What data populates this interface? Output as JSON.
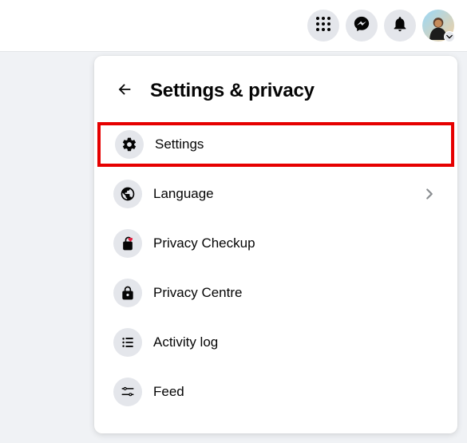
{
  "header": {
    "title": "Settings & privacy"
  },
  "topbar": {
    "icons": {
      "menu": "apps-grid-icon",
      "messenger": "messenger-icon",
      "notifications": "bell-icon",
      "account": "account-avatar"
    }
  },
  "menu": {
    "items": [
      {
        "label": "Settings",
        "icon": "gear-icon",
        "highlighted": true
      },
      {
        "label": "Language",
        "icon": "globe-icon",
        "has_chevron": true
      },
      {
        "label": "Privacy Checkup",
        "icon": "lock-heart-icon"
      },
      {
        "label": "Privacy Centre",
        "icon": "lock-icon"
      },
      {
        "label": "Activity log",
        "icon": "list-icon"
      },
      {
        "label": "Feed",
        "icon": "sliders-icon"
      }
    ]
  },
  "colors": {
    "highlight_border": "#e60000",
    "icon_bg": "#e4e6eb",
    "panel_bg": "#ffffff",
    "page_bg": "#f0f2f5"
  }
}
